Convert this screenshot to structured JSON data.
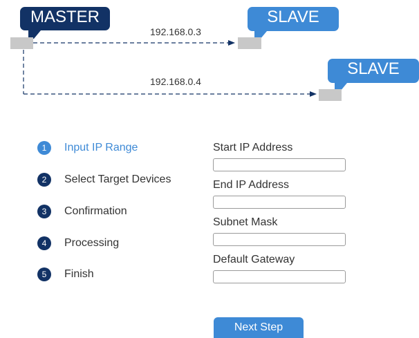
{
  "diagram": {
    "master_label": "MASTER",
    "slave1_label": "SLAVE",
    "slave2_label": "SLAVE",
    "ip1": "192.168.0.3",
    "ip2": "192.168.0.4"
  },
  "wizard": {
    "steps": [
      {
        "number": "1",
        "label": "Input IP Range",
        "active": true
      },
      {
        "number": "2",
        "label": "Select Target Devices",
        "active": false
      },
      {
        "number": "3",
        "label": "Confirmation",
        "active": false
      },
      {
        "number": "4",
        "label": "Processing",
        "active": false
      },
      {
        "number": "5",
        "label": "Finish",
        "active": false
      }
    ]
  },
  "form": {
    "start_ip_label": "Start IP Address",
    "start_ip_value": "",
    "end_ip_label": "End IP Address",
    "end_ip_value": "",
    "subnet_label": "Subnet Mask",
    "subnet_value": "",
    "gateway_label": "Default Gateway",
    "gateway_value": ""
  },
  "next_button_label": "Next Step",
  "colors": {
    "dark_navy": "#123265",
    "accent_blue": "#3e8ad6",
    "device_gray": "#c8c8c8",
    "text": "#333333"
  }
}
